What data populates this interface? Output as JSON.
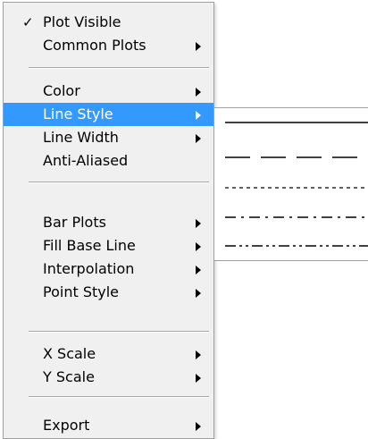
{
  "menu": {
    "plot_visible": {
      "label": "Plot Visible",
      "checked": true,
      "check_glyph": "✓"
    },
    "common_plots": {
      "label": "Common Plots"
    },
    "color": {
      "label": "Color"
    },
    "line_style": {
      "label": "Line Style",
      "selected": true
    },
    "line_width": {
      "label": "Line Width"
    },
    "anti_aliased": {
      "label": "Anti-Aliased"
    },
    "bar_plots": {
      "label": "Bar Plots"
    },
    "fill_base_line": {
      "label": "Fill Base Line"
    },
    "interpolation": {
      "label": "Interpolation"
    },
    "point_style": {
      "label": "Point Style"
    },
    "x_scale": {
      "label": "X Scale"
    },
    "y_scale": {
      "label": "Y Scale"
    },
    "export": {
      "label": "Export"
    }
  },
  "line_style_submenu": {
    "options": [
      "solid",
      "dashed",
      "dotted",
      "dash-dot",
      "dash-dot-dot"
    ]
  },
  "colors": {
    "menu_background": "#f0f0f0",
    "selected_background": "#3399ff",
    "selected_text": "#ffffff",
    "separator": "#a6a6a6"
  }
}
